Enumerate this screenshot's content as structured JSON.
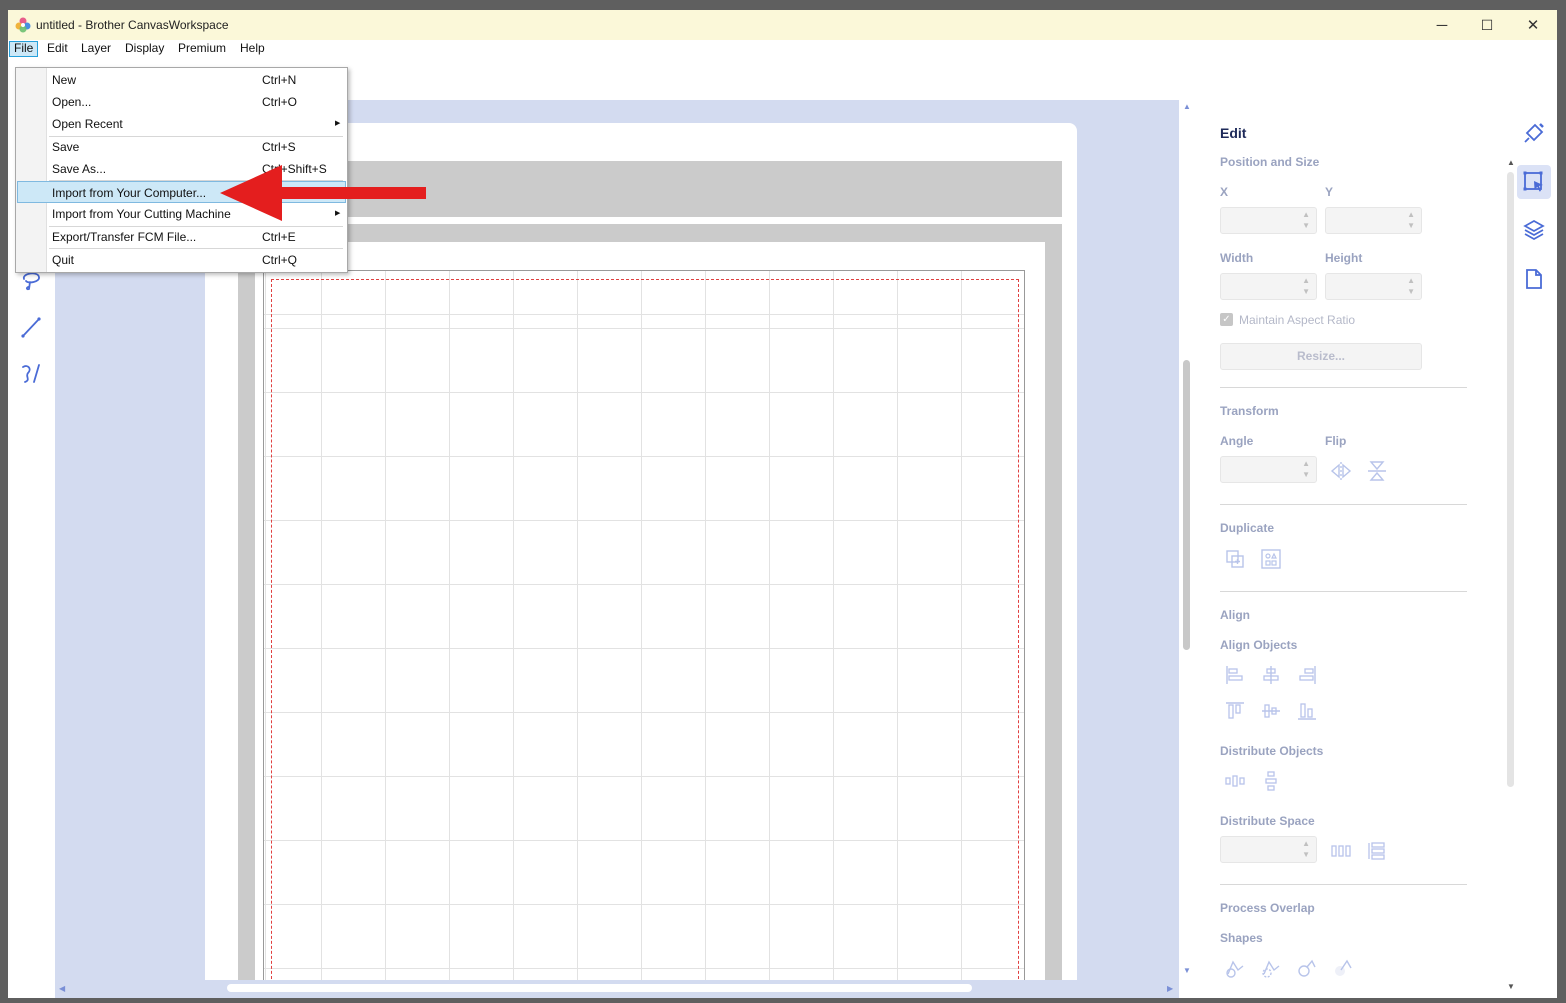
{
  "window": {
    "title": "untitled - Brother CanvasWorkspace",
    "buttons": {
      "minimize": "─",
      "maximize": "☐",
      "close": "✕"
    }
  },
  "menubar": [
    "File",
    "Edit",
    "Layer",
    "Display",
    "Premium",
    "Help"
  ],
  "file_menu": {
    "items": [
      {
        "label": "New",
        "shortcut": "Ctrl+N"
      },
      {
        "label": "Open...",
        "shortcut": "Ctrl+O"
      },
      {
        "label": "Open Recent",
        "shortcut": "",
        "submenu": true
      },
      {
        "label": "Save",
        "shortcut": "Ctrl+S"
      },
      {
        "label": "Save As...",
        "shortcut": "Ctrl+Shift+S"
      },
      {
        "label": "Import from Your Computer...",
        "shortcut": "",
        "highlighted": true
      },
      {
        "label": "Import from Your Cutting Machine",
        "shortcut": "",
        "submenu": true
      },
      {
        "label": "Export/Transfer FCM File...",
        "shortcut": "Ctrl+E"
      },
      {
        "label": "Quit",
        "shortcut": "Ctrl+Q"
      }
    ],
    "submenu_arrow": "▶"
  },
  "left_tools": [
    "lasso-icon",
    "line-icon",
    "freehand-icon"
  ],
  "edit_panel": {
    "title": "Edit",
    "position_size": {
      "heading": "Position and Size",
      "x_label": "X",
      "y_label": "Y",
      "width_label": "Width",
      "height_label": "Height",
      "aspect_ratio_label": "Maintain Aspect Ratio",
      "aspect_ratio_checked": true,
      "resize_label": "Resize..."
    },
    "transform": {
      "heading": "Transform",
      "angle_label": "Angle",
      "flip_label": "Flip"
    },
    "duplicate": {
      "heading": "Duplicate"
    },
    "align": {
      "heading": "Align",
      "align_objects_label": "Align Objects",
      "distribute_objects_label": "Distribute Objects",
      "distribute_space_label": "Distribute Space"
    },
    "process_overlap": {
      "heading": "Process Overlap",
      "shapes_label": "Shapes"
    }
  },
  "right_rail": [
    "brush-icon",
    "select-transform-icon",
    "layers-icon",
    "page-icon"
  ],
  "colors": {
    "title_bg": "#fbf8d9",
    "canvas_bg": "#d3dbf0",
    "menu_highlight": "#cde8f7",
    "accent": "#4a6bd6",
    "arrow_red": "#e41e1e"
  }
}
